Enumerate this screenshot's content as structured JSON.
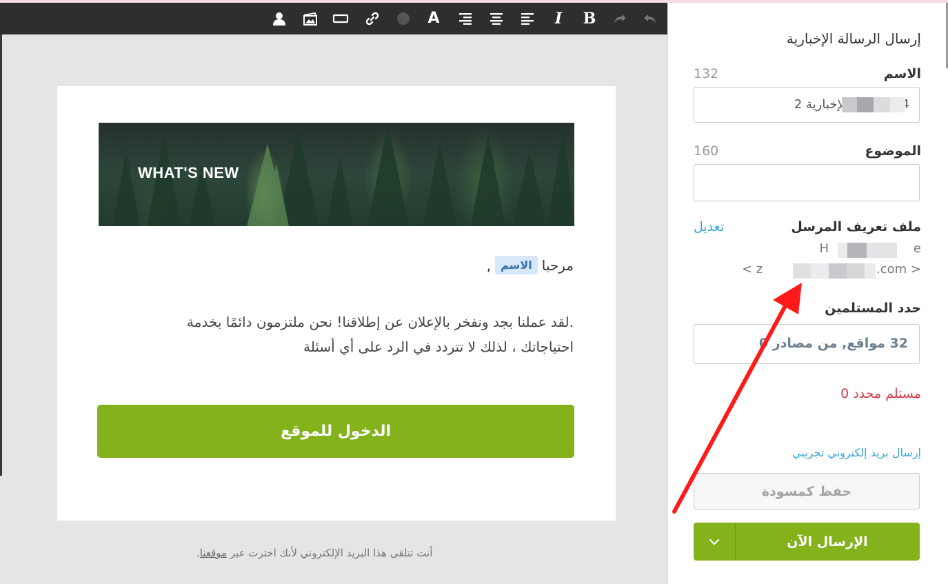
{
  "toolbar": {
    "buttons": [
      {
        "name": "undo-icon",
        "glyph": "↶"
      },
      {
        "name": "redo-icon",
        "glyph": "↷"
      },
      {
        "name": "bold-button",
        "glyph": "B"
      },
      {
        "name": "italic-button",
        "glyph": "I"
      },
      {
        "name": "align-left-icon"
      },
      {
        "name": "align-center-icon"
      },
      {
        "name": "align-right-icon"
      },
      {
        "name": "font-color-button",
        "glyph": "A"
      },
      {
        "name": "color-picker-icon"
      },
      {
        "name": "link-icon"
      },
      {
        "name": "button-block-icon"
      },
      {
        "name": "image-icon"
      },
      {
        "name": "personalize-user-icon"
      }
    ],
    "bg_color": "#2e2e2e"
  },
  "email": {
    "banner_text": "WHAT'S NEW",
    "greeting": "مرحبا",
    "merge_tag": "الاسم",
    "greeting_suffix": ",",
    "body_line1": ".لقد عملنا بجد ونفخر بالإعلان عن إطلاقنا! نحن ملتزمون دائمًا بخدمة",
    "body_line2": "احتياجاتك ، لذلك لا تتردد في الرد على أي أسئلة",
    "cta_label": "الدخول للموقع",
    "cta_color": "#84b21a"
  },
  "footer": {
    "note_prefix": "أنت تتلقى هذا البريد الإلكتروني لأنك اخترت عبر ",
    "note_link": "موقعنا",
    "note_suffix": "."
  },
  "panel": {
    "title": "إرسال الرسالة الإخبارية",
    "name_label": "الاسم",
    "name_count": "132",
    "name_value": "الرسائل الإخبارية 2",
    "name_value_tail": "4",
    "subject_label": "الموضوع",
    "subject_count": "160",
    "subject_value": "",
    "sender_label": "ملف تعريف المرسل",
    "edit_link": "تعديل",
    "sender_name_start": "H",
    "sender_name_end": "e",
    "sender_email_start": "< z",
    "sender_email_end": "5.com >",
    "recipients_label": "حدد المستلمين",
    "recipients_value": "32 مواقع, من مصادر 0",
    "selected_count": "مستلم محدد 0",
    "test_email_link": "إرسال بريد إلكتروني تجريبي",
    "draft_button": "حفظ كمسودة",
    "send_button": "الإرسال الآن",
    "send_dropdown_icon": "chevron-down-icon",
    "accent_color": "#84b21a",
    "link_color": "#3aa6d8",
    "error_color": "#d83a4a"
  },
  "annotation": {
    "arrow_color": "#ff1a1a"
  }
}
